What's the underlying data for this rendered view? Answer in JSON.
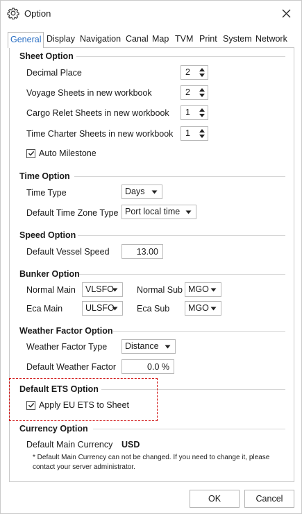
{
  "window": {
    "title": "Option",
    "icon": "gear-icon",
    "close_icon": "close-icon"
  },
  "tabs": [
    {
      "label": "General",
      "active": true
    },
    {
      "label": "Display"
    },
    {
      "label": "Navigation"
    },
    {
      "label": "Canal"
    },
    {
      "label": "Map"
    },
    {
      "label": "TVM"
    },
    {
      "label": "Print"
    },
    {
      "label": "System"
    },
    {
      "label": "Network"
    }
  ],
  "sheet_option": {
    "title": "Sheet Option",
    "decimal_place": {
      "label": "Decimal Place",
      "value": "2"
    },
    "voyage_sheets": {
      "label": "Voyage Sheets in new workbook",
      "value": "2"
    },
    "cargo_relet_sheets": {
      "label": "Cargo Relet Sheets in new workbook",
      "value": "1"
    },
    "time_charter_sheets": {
      "label": "Time Charter Sheets in new workbook",
      "value": "1"
    },
    "auto_milestone": {
      "label": "Auto Milestone",
      "checked": true
    }
  },
  "time_option": {
    "title": "Time Option",
    "time_type": {
      "label": "Time Type",
      "value": "Days"
    },
    "default_time_zone": {
      "label": "Default Time Zone Type",
      "value": "Port local time"
    }
  },
  "speed_option": {
    "title": "Speed Option",
    "default_vessel_speed": {
      "label": "Default Vessel Speed",
      "value": "13.00"
    }
  },
  "bunker_option": {
    "title": "Bunker Option",
    "normal_main": {
      "label": "Normal Main",
      "value": "VLSFO"
    },
    "normal_sub": {
      "label": "Normal Sub",
      "value": "MGO"
    },
    "eca_main": {
      "label": "Eca Main",
      "value": "ULSFO"
    },
    "eca_sub": {
      "label": "Eca Sub",
      "value": "MGO"
    }
  },
  "weather_factor_option": {
    "title": "Weather Factor Option",
    "weather_factor_type": {
      "label": "Weather Factor Type",
      "value": "Distance"
    },
    "default_weather_factor": {
      "label": "Default Weather Factor",
      "value": "0.0 %"
    }
  },
  "ets_option": {
    "title": "Default ETS Option",
    "apply_eu_ets": {
      "label": "Apply EU ETS to Sheet",
      "checked": true
    }
  },
  "currency_option": {
    "title": "Currency Option",
    "default_main_currency": {
      "label": "Default Main Currency",
      "value": "USD"
    },
    "note_line1": "* Default Main Currency can not be changed. If you need to change it, please",
    "note_line2": "contact your server administrator."
  },
  "footer": {
    "ok_label": "OK",
    "cancel_label": "Cancel"
  },
  "colors": {
    "active_tab": "#2a6fc4",
    "highlight_border": "#d01010"
  }
}
